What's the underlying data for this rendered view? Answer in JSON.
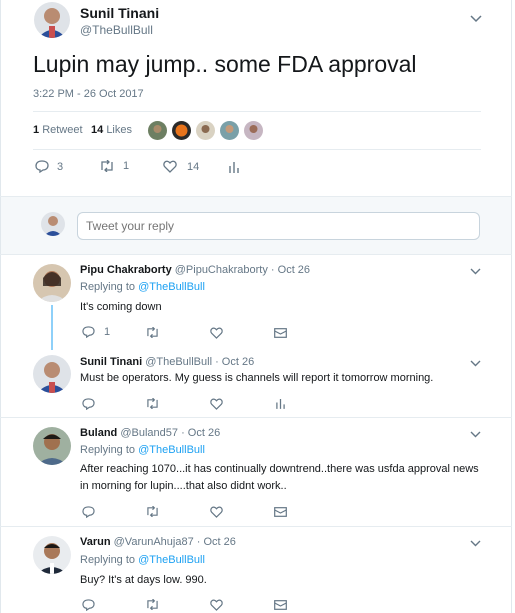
{
  "tweet": {
    "author_name": "Sunil Tinani",
    "author_handle": "@TheBullBull",
    "text": "Lupin may jump.. some FDA approval",
    "timestamp": "3:22 PM - 26 Oct 2017",
    "retweets_count": "1",
    "retweets_label": "Retweet",
    "likes_count": "14",
    "likes_label": "Likes",
    "action_reply_count": "3",
    "action_retweet_count": "1",
    "action_like_count": "14"
  },
  "reply_composer": {
    "placeholder": "Tweet your reply"
  },
  "replies": [
    {
      "name": "Pipu Chakraborty",
      "handle": "@PipuChakraborty",
      "date": "· Oct 26",
      "replying_label": "Replying to",
      "replying_to": "@TheBullBull",
      "text": "It's coming down",
      "reply_count": "1"
    },
    {
      "name": "Sunil Tinani",
      "handle": "@TheBullBull",
      "date": "· Oct 26",
      "text": "Must be operators. My guess is channels will report it tomorrow morning."
    },
    {
      "name": "Buland",
      "handle": "@Buland57",
      "date": "· Oct 26",
      "replying_label": "Replying to",
      "replying_to": "@TheBullBull",
      "text_line1": "After reaching 1070...it has continually downtrend..there was usfda approval news",
      "text_line2": "in morning for lupin....that also didnt work.."
    },
    {
      "name": "Varun",
      "handle": "@VarunAhuja87",
      "date": "· Oct 26",
      "replying_label": "Replying to",
      "replying_to": "@TheBullBull",
      "text": "Buy? It's at days low. 990."
    }
  ],
  "icons": {
    "reply": "reply-icon",
    "retweet": "retweet-icon",
    "like": "heart-icon",
    "analytics": "analytics-icon",
    "message": "envelope-icon",
    "more": "chevron-down-icon"
  },
  "colors": {
    "accent": "#1da1f2",
    "muted": "#657786",
    "thread_line": "#8ed0f9",
    "divider": "#e6ecf0"
  }
}
